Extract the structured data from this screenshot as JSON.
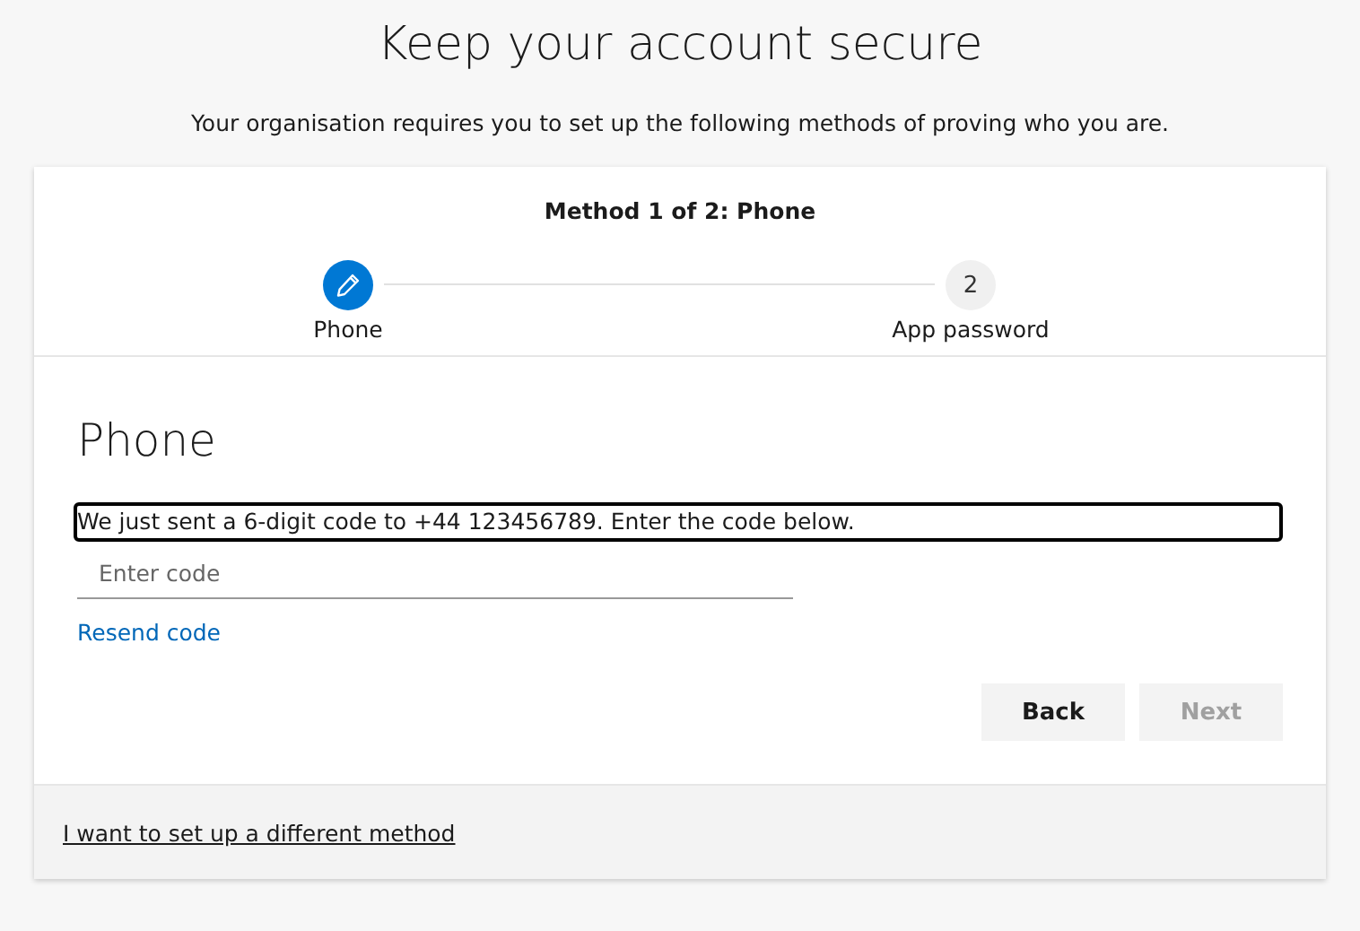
{
  "title": "Keep your account secure",
  "subtitle": "Your organisation requires you to set up the following methods of proving who you are.",
  "progress": {
    "heading": "Method 1 of 2: Phone",
    "steps": [
      {
        "label": "Phone",
        "selected": true
      },
      {
        "label": "App password",
        "number": "2",
        "selected": false
      }
    ]
  },
  "method": {
    "heading": "Phone",
    "instruction": "We just sent a 6-digit code to +44 123456789. Enter the code below.",
    "instruction_focused": true,
    "code_field": {
      "placeholder": "Enter code"
    },
    "resend_link": "Resend code"
  },
  "buttons": [
    {
      "label": "Back",
      "disabled": false
    },
    {
      "label": "Next",
      "disabled": true
    }
  ],
  "footer_link": "I want to set up a different method"
}
